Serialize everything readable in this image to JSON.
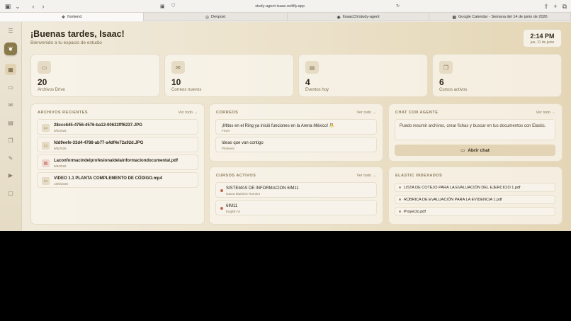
{
  "browser": {
    "url": "study-agent-isaac.netlify.app",
    "tabs": [
      {
        "icon": "❖",
        "label": "frontend"
      },
      {
        "icon": "◎",
        "label": "Devpost"
      },
      {
        "icon": "◉",
        "label": "IIsaacCh/study-agent"
      },
      {
        "icon": "▦",
        "label": "Google Calendar - Semana del 14 de junio de 2026"
      }
    ]
  },
  "header": {
    "greeting": "¡Buenas tardes, Isaac!",
    "subtitle": "Bienvenido a tu espacio de estudio",
    "time": "2:14 PM",
    "date": "jue, 11 de junio"
  },
  "stats": [
    {
      "icon": "drive-icon",
      "value": "20",
      "label": "Archivos Drive"
    },
    {
      "icon": "mail-icon",
      "value": "10",
      "label": "Correos nuevos"
    },
    {
      "icon": "calendar-icon",
      "value": "4",
      "label": "Eventos hoy"
    },
    {
      "icon": "book-icon",
      "value": "6",
      "label": "Cursos activos"
    }
  ],
  "files": {
    "title": "ARCHIVOS RECIENTES",
    "link": "Ver todo →",
    "items": [
      {
        "name": "28ccc645-4756-4576-ba12-00622fff6237.JPG",
        "date": "9/6/2026",
        "type": "img"
      },
      {
        "name": "fdd9eefe-33d4-4788-ab77-a4df4e72a92d.JPG",
        "date": "9/6/2026",
        "type": "img"
      },
      {
        "name": "Laconformacindelprofesionaldelainformaciondocumental.pdf",
        "date": "9/6/2026",
        "type": "pdf"
      },
      {
        "name": "VIDEO 1.1 PLANTA COMPLEMENTO DE CÓDIGO.mp4",
        "date": "18/5/2026",
        "type": "img"
      }
    ]
  },
  "emails": {
    "title": "CORREOS",
    "link": "Ver todo →",
    "items": [
      {
        "subject": "¡Mitos en el Ring ya inició funciones en la Arena México! 🤼",
        "from": "Fever"
      },
      {
        "subject": "Ideas que van contigo",
        "from": "Pinterest"
      }
    ]
  },
  "chat": {
    "title": "CHAT CON AGENTE",
    "link": "Ver todo →",
    "message": "Puedo resumir archivos, crear fichas y buscar en tus documentos con Elastic.",
    "button": "Abrir chat"
  },
  "courses": {
    "title": "CURSOS ACTIVOS",
    "link": "Ver todo →",
    "items": [
      {
        "name": "SISTEMAS DE INFORMACION 6IM11",
        "teacher": "Isaura Martinez Romero"
      },
      {
        "name": "6IM11",
        "teacher": "English VI"
      }
    ]
  },
  "elastic": {
    "title": "ELASTIC INDEXADOS",
    "items": [
      "LISTA DE COTEJO PARA LA EVALUACIÓN DEL EJERCICIO 1.pdf",
      "RÚBRICA DE EVALUACIÓN PARA LA EVIDENCIA 1.pdf",
      "Proyecto.pdf"
    ]
  },
  "colors": {
    "accent": "#e2d4b4",
    "background": "#ece2cb",
    "pdf": "#b0533e"
  }
}
